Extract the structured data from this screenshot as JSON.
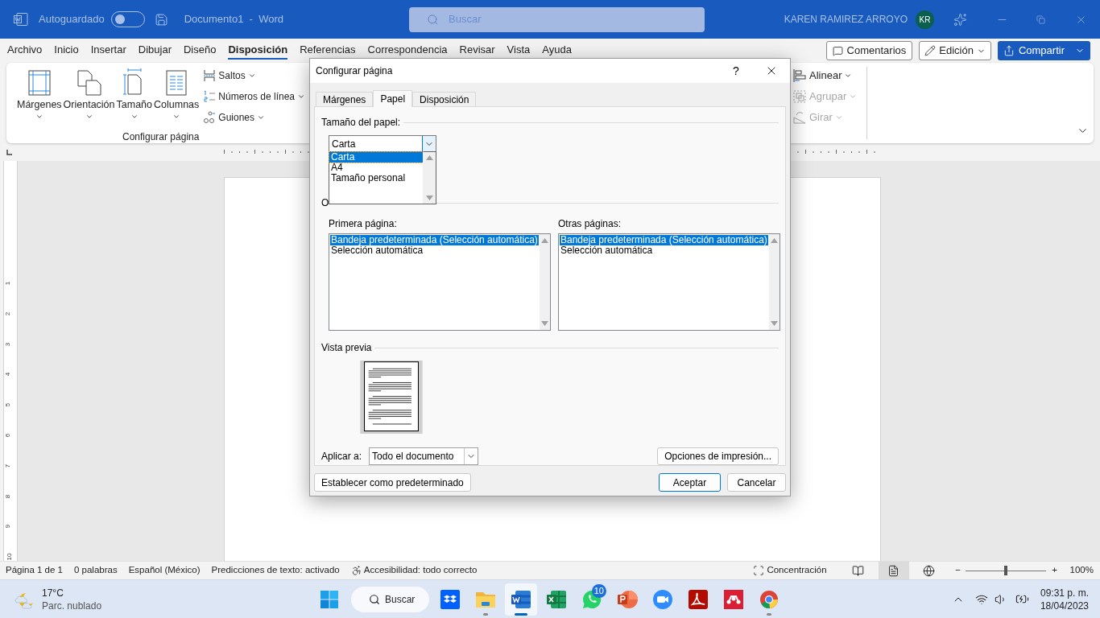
{
  "titlebar": {
    "autosave_label": "Autoguardado",
    "autosave_on": false,
    "document_title": "Documento1  -  Word",
    "search_placeholder": "Buscar",
    "user": "KAREN RAMIREZ ARROYO",
    "avatar": "KR"
  },
  "menu": [
    {
      "label": "Archivo",
      "selected": false
    },
    {
      "label": "Inicio",
      "selected": false
    },
    {
      "label": "Insertar",
      "selected": false
    },
    {
      "label": "Dibujar",
      "selected": false
    },
    {
      "label": "Diseño",
      "selected": false
    },
    {
      "label": "Disposición",
      "selected": true
    },
    {
      "label": "Referencias",
      "selected": false
    },
    {
      "label": "Correspondencia",
      "selected": false
    },
    {
      "label": "Revisar",
      "selected": false
    },
    {
      "label": "Vista",
      "selected": false
    },
    {
      "label": "Ayuda",
      "selected": false
    }
  ],
  "menu_buttons": {
    "comments": "Comentarios",
    "editing": "Edición",
    "share": "Compartir"
  },
  "ribbon": {
    "large_buttons": [
      {
        "label": "Márgenes",
        "kind": "margins"
      },
      {
        "label": "Orientación",
        "kind": "orientation"
      },
      {
        "label": "Tamaño",
        "kind": "size"
      },
      {
        "label": "Columnas",
        "kind": "columns"
      }
    ],
    "small_buttons": [
      {
        "label": "Saltos",
        "kind": "breaks"
      },
      {
        "label": "Números de línea",
        "kind": "line_numbers"
      },
      {
        "label": "Guiones",
        "kind": "hyphenation"
      }
    ],
    "group_label": "Configurar página",
    "arrange": [
      {
        "label": "Alinear",
        "kind": "align",
        "disabled": false
      },
      {
        "label": "Agrupar",
        "kind": "group",
        "disabled": true
      },
      {
        "label": "Girar",
        "kind": "rotate",
        "disabled": true
      }
    ]
  },
  "vertical_ruler": [
    "1",
    "2",
    "3",
    "4",
    "5",
    "6",
    "7",
    "8",
    "9",
    "10"
  ],
  "dialog": {
    "title": "Configurar página",
    "help": "?",
    "tabs": [
      {
        "label": "Márgenes",
        "selected": false
      },
      {
        "label": "Papel",
        "selected": true
      },
      {
        "label": "Disposición",
        "selected": false
      }
    ],
    "paper_size": {
      "label": "Tamaño del papel:",
      "value": "Carta",
      "options": [
        {
          "label": "Carta",
          "selected": true
        },
        {
          "label": "A4",
          "selected": false
        },
        {
          "label": "Tamaño personal",
          "selected": false
        }
      ]
    },
    "paper_source": {
      "label": "O",
      "lists": [
        {
          "label": "Primera página:",
          "items": [
            {
              "label": "Bandeja predeterminada (Selección automática)",
              "selected": true
            },
            {
              "label": "Selección automática",
              "selected": false
            }
          ]
        },
        {
          "label": "Otras páginas:",
          "items": [
            {
              "label": "Bandeja predeterminada (Selección automática)",
              "selected": true
            },
            {
              "label": "Selección automática",
              "selected": false
            }
          ]
        }
      ]
    },
    "preview_label": "Vista previa",
    "apply_to": {
      "label": "Aplicar a:",
      "value": "Todo el documento"
    },
    "print_options": "Opciones de impresión...",
    "set_default": "Establecer como predeterminado",
    "ok": "Aceptar",
    "cancel": "Cancelar"
  },
  "status_bar": {
    "items": [
      "Página 1 de 1",
      "0 palabras",
      "Español (México)",
      "Predicciones de texto: activado"
    ],
    "accessibility": "Accesibilidad: todo correcto",
    "focus": "Concentración",
    "views": [
      {
        "kind": "read",
        "selected": false
      },
      {
        "kind": "print",
        "selected": true
      },
      {
        "kind": "web",
        "selected": false
      }
    ],
    "zoom": {
      "minus": "−",
      "plus": "+",
      "level": 0.5,
      "value": "100%"
    }
  },
  "taskbar": {
    "weather": {
      "temp": "17°C",
      "desc": "Parc. nublado"
    },
    "search": "Buscar",
    "apps": [
      {
        "kind": "dropbox",
        "running": false,
        "selected": false
      },
      {
        "kind": "folder",
        "running": true,
        "selected": false
      },
      {
        "kind": "word",
        "running": true,
        "selected": true
      },
      {
        "kind": "excel",
        "running": false,
        "selected": false
      },
      {
        "kind": "whatsapp",
        "running": false,
        "selected": false,
        "badge": "10"
      },
      {
        "kind": "powerpoint",
        "running": false,
        "selected": false
      },
      {
        "kind": "zoom",
        "running": false,
        "selected": false
      },
      {
        "kind": "acrobat",
        "running": false,
        "selected": false
      },
      {
        "kind": "mendeley",
        "running": false,
        "selected": false
      },
      {
        "kind": "chrome",
        "running": true,
        "selected": false
      }
    ],
    "time": "09:31 p. m.",
    "date": "18/04/2023"
  }
}
